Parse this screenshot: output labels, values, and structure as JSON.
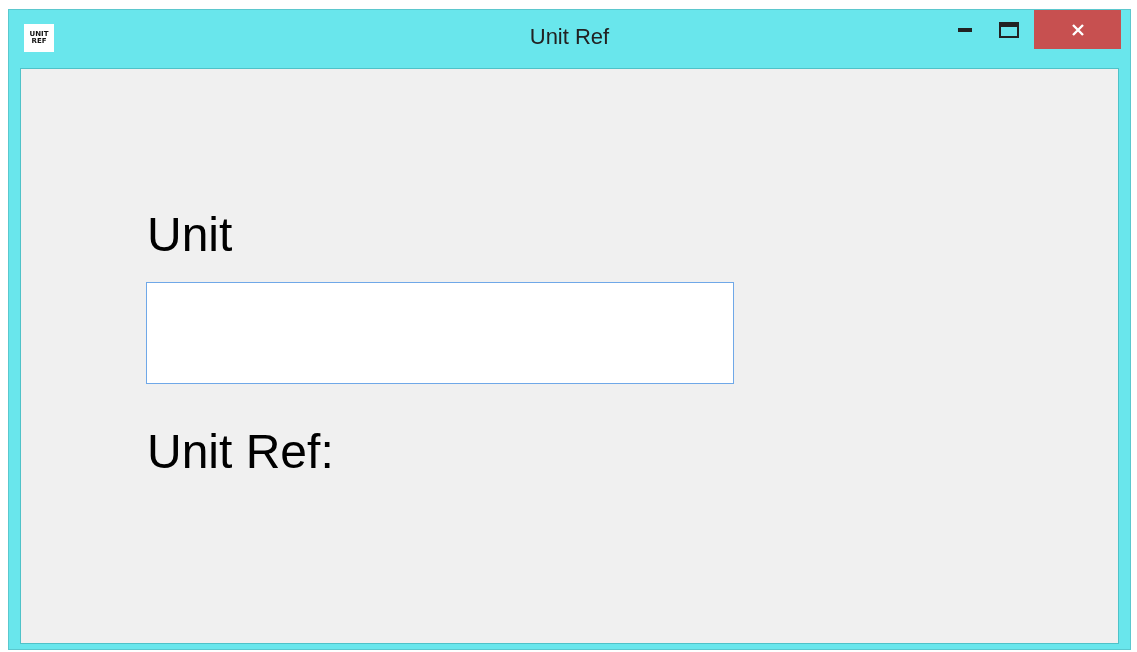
{
  "window": {
    "title": "Unit Ref",
    "app_icon": [
      "UNIT",
      "REF"
    ]
  },
  "form": {
    "unit_label": "Unit",
    "unit_field": {
      "focused": true
    },
    "result_label": "Unit Ref:"
  }
}
